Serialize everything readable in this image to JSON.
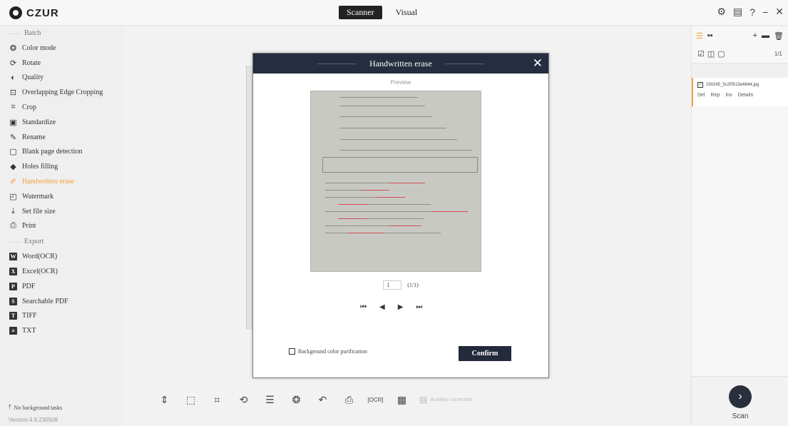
{
  "app": {
    "logo": "CZUR"
  },
  "modes": [
    "Scanner",
    "Visual"
  ],
  "window_controls": [
    "settings-icon",
    "chat-icon",
    "help-icon",
    "minimize-icon",
    "close-icon"
  ],
  "sidebar": {
    "batch_section": "Batch",
    "batch_items": [
      {
        "label": "Color mode",
        "icon": "color-mode-icon"
      },
      {
        "label": "Rotate",
        "icon": "rotate-icon"
      },
      {
        "label": "Quality",
        "icon": "quality-icon"
      },
      {
        "label": "Overlapping Edge Cropping",
        "icon": "edge-crop-icon"
      },
      {
        "label": "Crop",
        "icon": "crop-icon"
      },
      {
        "label": "Standardize",
        "icon": "standardize-icon"
      },
      {
        "label": "Rename",
        "icon": "rename-icon"
      },
      {
        "label": "Blank page detection",
        "icon": "blank-page-icon"
      },
      {
        "label": "Holes filling",
        "icon": "fill-icon"
      },
      {
        "label": "Handwritten erase",
        "icon": "eraser-icon",
        "active": true
      },
      {
        "label": "Watermark",
        "icon": "watermark-icon"
      },
      {
        "label": "Set file size",
        "icon": "file-size-icon"
      },
      {
        "label": "Print",
        "icon": "print-icon"
      }
    ],
    "export_section": "Export",
    "export_items": [
      {
        "label": "Word(OCR)",
        "badge": "W"
      },
      {
        "label": "Excel(OCR)",
        "badge": "X"
      },
      {
        "label": "PDF",
        "badge": "P"
      },
      {
        "label": "Searchable PDF",
        "badge": "S"
      },
      {
        "label": "TIFF",
        "badge": "T"
      },
      {
        "label": "TXT",
        "badge": "≡"
      }
    ],
    "background_tasks": "No background tasks",
    "version": "Version:4.9.230508"
  },
  "dialog": {
    "title": "Handwritten erase",
    "preview_label": "Preview",
    "page_number": "1",
    "page_total": "(1/1)",
    "pager": [
      "first-page-icon",
      "prev-page-icon",
      "next-page-icon",
      "last-page-icon"
    ],
    "background_purification_label": "Background color purification",
    "background_purification_checked": false,
    "confirm_label": "Confirm"
  },
  "toolbar": {
    "tools": [
      "fit-height-icon",
      "select-area-icon",
      "crop-icon",
      "rotate-crop-icon",
      "adjust-icon",
      "color-mode-icon",
      "undo-icon",
      "print-icon",
      "ocr-icon",
      "qr-code-icon"
    ],
    "auxiliary_label": "Auxiliary correction"
  },
  "right_panel": {
    "page_count": "1/1",
    "file": {
      "name": "150245_5c2f0515e6644.jpg",
      "checked": true
    },
    "file_actions": [
      "Del",
      "Rep",
      "Ins",
      "Details"
    ],
    "scan_label": "Scan"
  },
  "colors": {
    "accent": "#f59e3a",
    "dark": "#252d40"
  }
}
